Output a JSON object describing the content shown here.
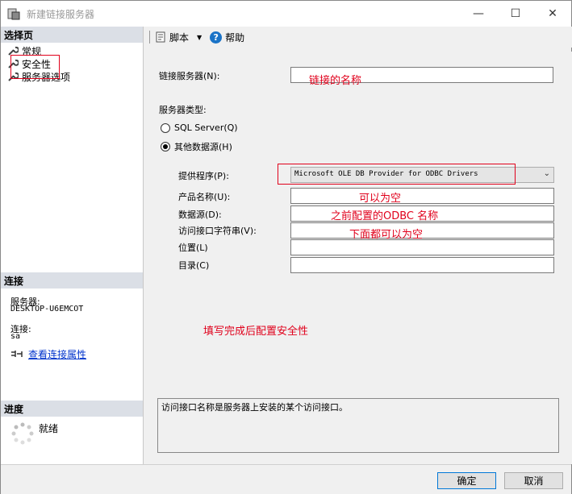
{
  "window": {
    "title": "新建链接服务器"
  },
  "left": {
    "select_page_header": "选择页",
    "nav_items": [
      {
        "label": "常规"
      },
      {
        "label": "安全性"
      },
      {
        "label": "服务器选项"
      }
    ],
    "connection_header": "连接",
    "server_label": "服务器:",
    "server_value": "DESKTOP-U6EMCOT",
    "connection_label": "连接:",
    "connection_value": "sa",
    "view_props_link": "查看连接属性",
    "progress_header": "进度",
    "progress_status": "就绪"
  },
  "toolbar": {
    "script_label": "脚本",
    "help_label": "帮助"
  },
  "form": {
    "linked_server_label": "链接服务器(N):",
    "linked_server_value": "",
    "server_type_label": "服务器类型:",
    "radio_sql_server": "SQL Server(Q)",
    "radio_other": "其他数据源(H)",
    "selected_radio": "other",
    "provider_label": "提供程序(P):",
    "provider_value": "Microsoft OLE DB Provider for ODBC Drivers",
    "product_name_label": "产品名称(U):",
    "data_source_label": "数据源(D):",
    "provider_string_label": "访问接口字符串(V):",
    "location_label": "位置(L)",
    "catalog_label": "目录(C)",
    "description": "访问接口名称是服务器上安装的某个访问接口。"
  },
  "annotations": {
    "linked_name": "链接的名称",
    "can_be_empty": "可以为空",
    "odbc_name": "之前配置的ODBC 名称",
    "below_can_be_empty": "下面都可以为空",
    "configure_security": "填写完成后配置安全性"
  },
  "footer": {
    "ok_label": "确定",
    "cancel_label": "取消"
  },
  "colors": {
    "annotation_red": "#e0001b",
    "accent_blue": "#0078d7",
    "link_blue": "#0033cc"
  }
}
